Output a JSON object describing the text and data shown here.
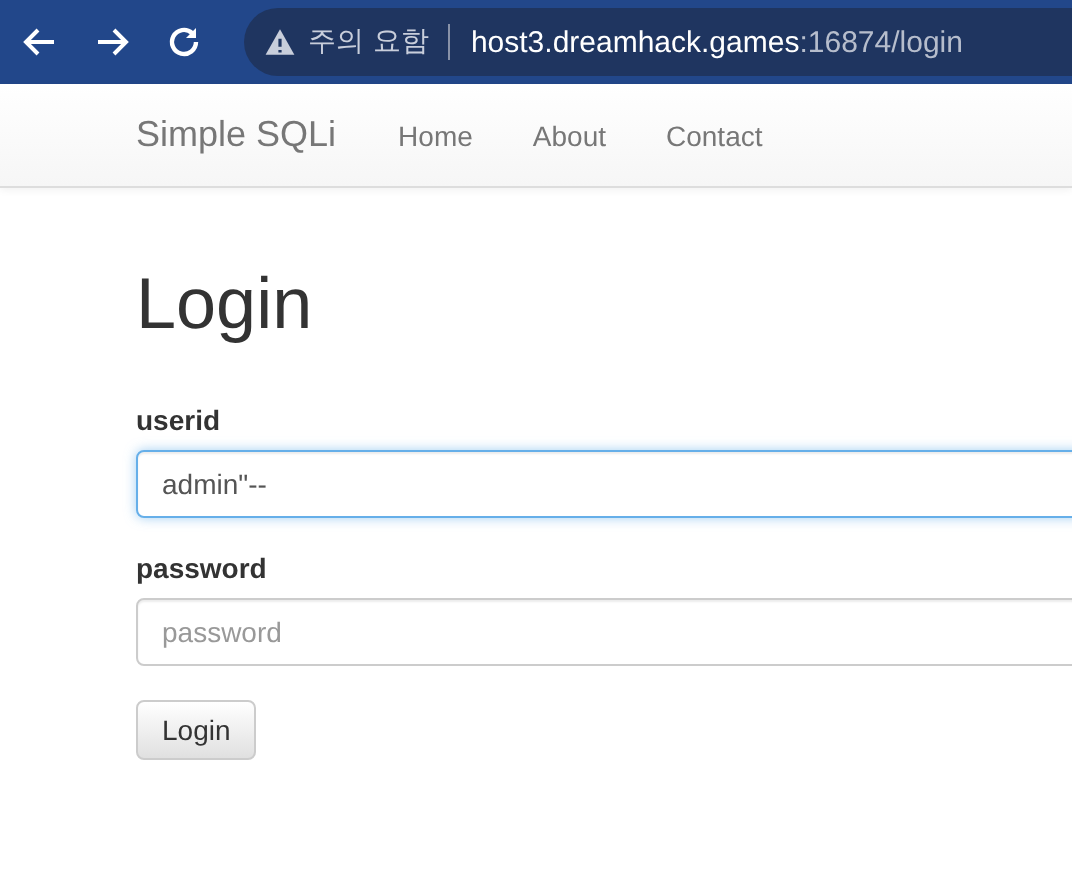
{
  "browser": {
    "warning": "주의 요함",
    "url_host": "host3.dreamhack.games",
    "url_path": ":16874/login"
  },
  "navbar": {
    "brand": "Simple SQLi",
    "links": [
      "Home",
      "About",
      "Contact"
    ]
  },
  "page": {
    "heading": "Login",
    "fields": [
      {
        "label": "userid",
        "value": "admin\"--",
        "focused": true
      },
      {
        "label": "password",
        "placeholder": "password",
        "focused": false
      }
    ],
    "submit": "Login"
  }
}
